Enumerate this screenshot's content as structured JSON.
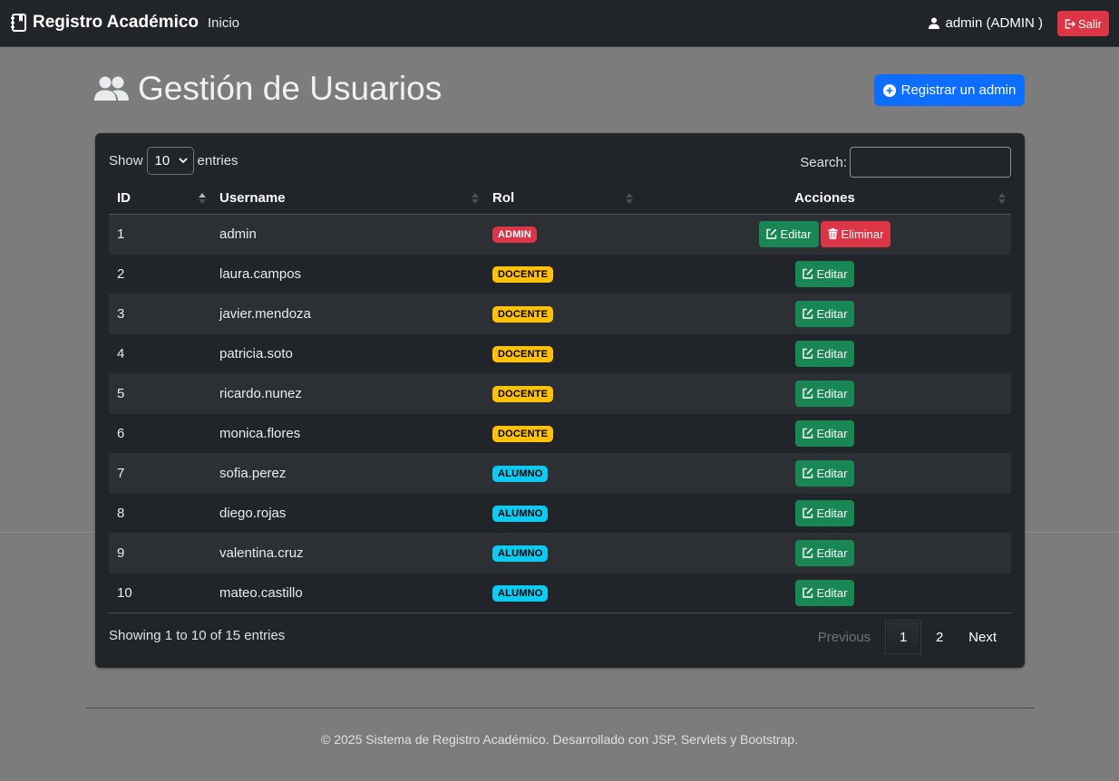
{
  "navbar": {
    "brand": "Registro Académico",
    "inicio": "Inicio",
    "user": "admin (ADMIN )",
    "logout": "Salir"
  },
  "page": {
    "title": "Gestión de Usuarios",
    "register_button": "Registrar un admin"
  },
  "table_controls": {
    "show": "Show",
    "length_value": "10",
    "entries": "entries",
    "search_label": "Search:",
    "search_value": ""
  },
  "table": {
    "headers": [
      "ID",
      "Username",
      "Rol",
      "Acciones"
    ],
    "rows": [
      {
        "id": "1",
        "username": "admin",
        "rol": "ADMIN",
        "edit": "Editar",
        "delete": "Eliminar"
      },
      {
        "id": "2",
        "username": "laura.campos",
        "rol": "DOCENTE",
        "edit": "Editar"
      },
      {
        "id": "3",
        "username": "javier.mendoza",
        "rol": "DOCENTE",
        "edit": "Editar"
      },
      {
        "id": "4",
        "username": "patricia.soto",
        "rol": "DOCENTE",
        "edit": "Editar"
      },
      {
        "id": "5",
        "username": "ricardo.nunez",
        "rol": "DOCENTE",
        "edit": "Editar"
      },
      {
        "id": "6",
        "username": "monica.flores",
        "rol": "DOCENTE",
        "edit": "Editar"
      },
      {
        "id": "7",
        "username": "sofia.perez",
        "rol": "ALUMNO",
        "edit": "Editar"
      },
      {
        "id": "8",
        "username": "diego.rojas",
        "rol": "ALUMNO",
        "edit": "Editar"
      },
      {
        "id": "9",
        "username": "valentina.cruz",
        "rol": "ALUMNO",
        "edit": "Editar"
      },
      {
        "id": "10",
        "username": "mateo.castillo",
        "rol": "ALUMNO",
        "edit": "Editar"
      }
    ]
  },
  "pagination": {
    "info": "Showing 1 to 10 of 15 entries",
    "previous": "Previous",
    "pages": [
      "1",
      "2"
    ],
    "active_page": "1",
    "next": "Next"
  },
  "footer": {
    "text": "© 2025 Sistema de Registro Académico. Desarrollado con JSP, Servlets y Bootstrap."
  },
  "colors": {
    "navbar_bg": "#212529",
    "page_bg": "#7c7c7c",
    "primary": "#0d6efd",
    "danger": "#dc3545",
    "success": "#198754",
    "warning": "#ffc107",
    "info": "#0dcaf0"
  },
  "icons": {
    "brand": "journal-bookmark-icon",
    "user": "person-icon",
    "logout": "box-arrow-right-icon",
    "title": "people-icon",
    "register": "plus-circle-icon",
    "edit": "pencil-square-icon",
    "delete": "trash-icon",
    "sort": "sort-arrows-icon"
  }
}
